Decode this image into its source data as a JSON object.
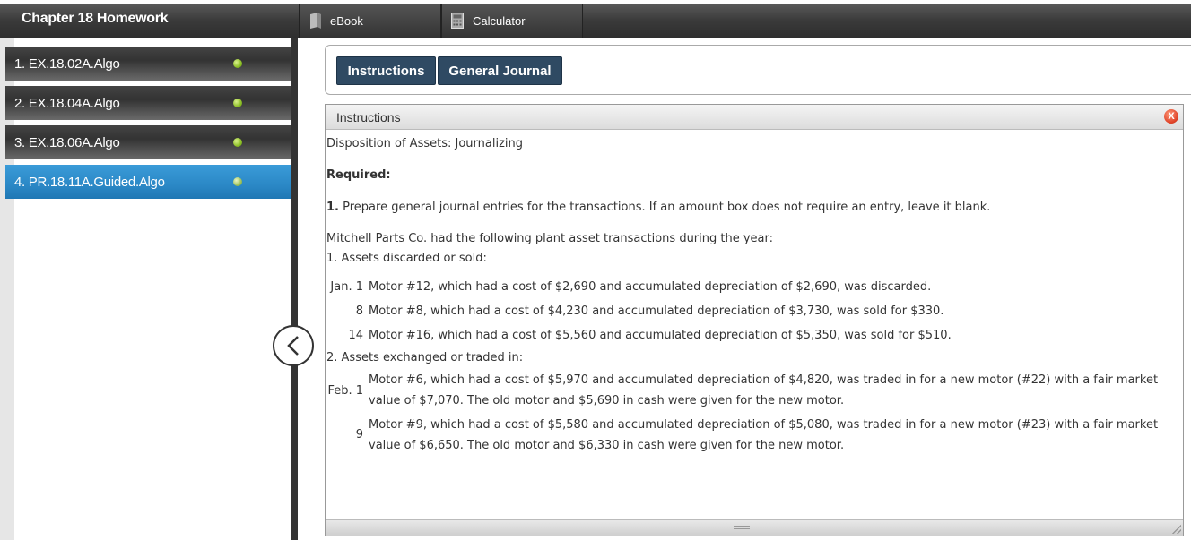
{
  "app": {
    "title": "Chapter 18 Homework"
  },
  "toolbar": {
    "ebook_label": "eBook",
    "calculator_label": "Calculator"
  },
  "sidebar": {
    "items": [
      {
        "label": "1. EX.18.02A.Algo",
        "active": false
      },
      {
        "label": "2. EX.18.04A.Algo",
        "active": false
      },
      {
        "label": "3. EX.18.06A.Algo",
        "active": false
      },
      {
        "label": "4. PR.18.11A.Guided.Algo",
        "active": true
      }
    ]
  },
  "tabs": {
    "instructions": "Instructions",
    "general_journal": "General Journal"
  },
  "panel": {
    "header": "Instructions",
    "close_glyph": "X",
    "heading": "Disposition of Assets: Journalizing",
    "required_label": "Required:",
    "step_number": "1.",
    "step_text": "Prepare general journal entries for the transactions. If an amount box does not require an entry, leave it blank.",
    "intro": "Mitchell Parts Co. had the following plant asset transactions during the year:",
    "section1": "1. Assets discarded or sold:",
    "section1_items": [
      {
        "date": "Jan. 1",
        "text": "Motor #12, which had a cost of $2,690 and accumulated depreciation of $2,690, was discarded."
      },
      {
        "date": "8",
        "text": "Motor #8, which had a cost of $4,230 and accumulated depreciation of $3,730, was sold for $330."
      },
      {
        "date": "14",
        "text": "Motor #16, which had a cost of $5,560 and accumulated depreciation of $5,350, was sold for $510."
      }
    ],
    "section2": "2. Assets exchanged or traded in:",
    "section2_items": [
      {
        "date": "Feb. 1",
        "text": "Motor #6, which had a cost of $5,970 and accumulated depreciation of $4,820, was traded in for a new motor (#22) with a fair market value of $7,070. The old motor and $5,690 in cash were given for the new motor."
      },
      {
        "date": "9",
        "text": "Motor #9, which had a cost of $5,580 and accumulated depreciation of $5,080, was traded in for a new motor (#23) with a fair market value of $6,650. The old motor and $6,330 in cash were given for the new motor."
      }
    ]
  }
}
